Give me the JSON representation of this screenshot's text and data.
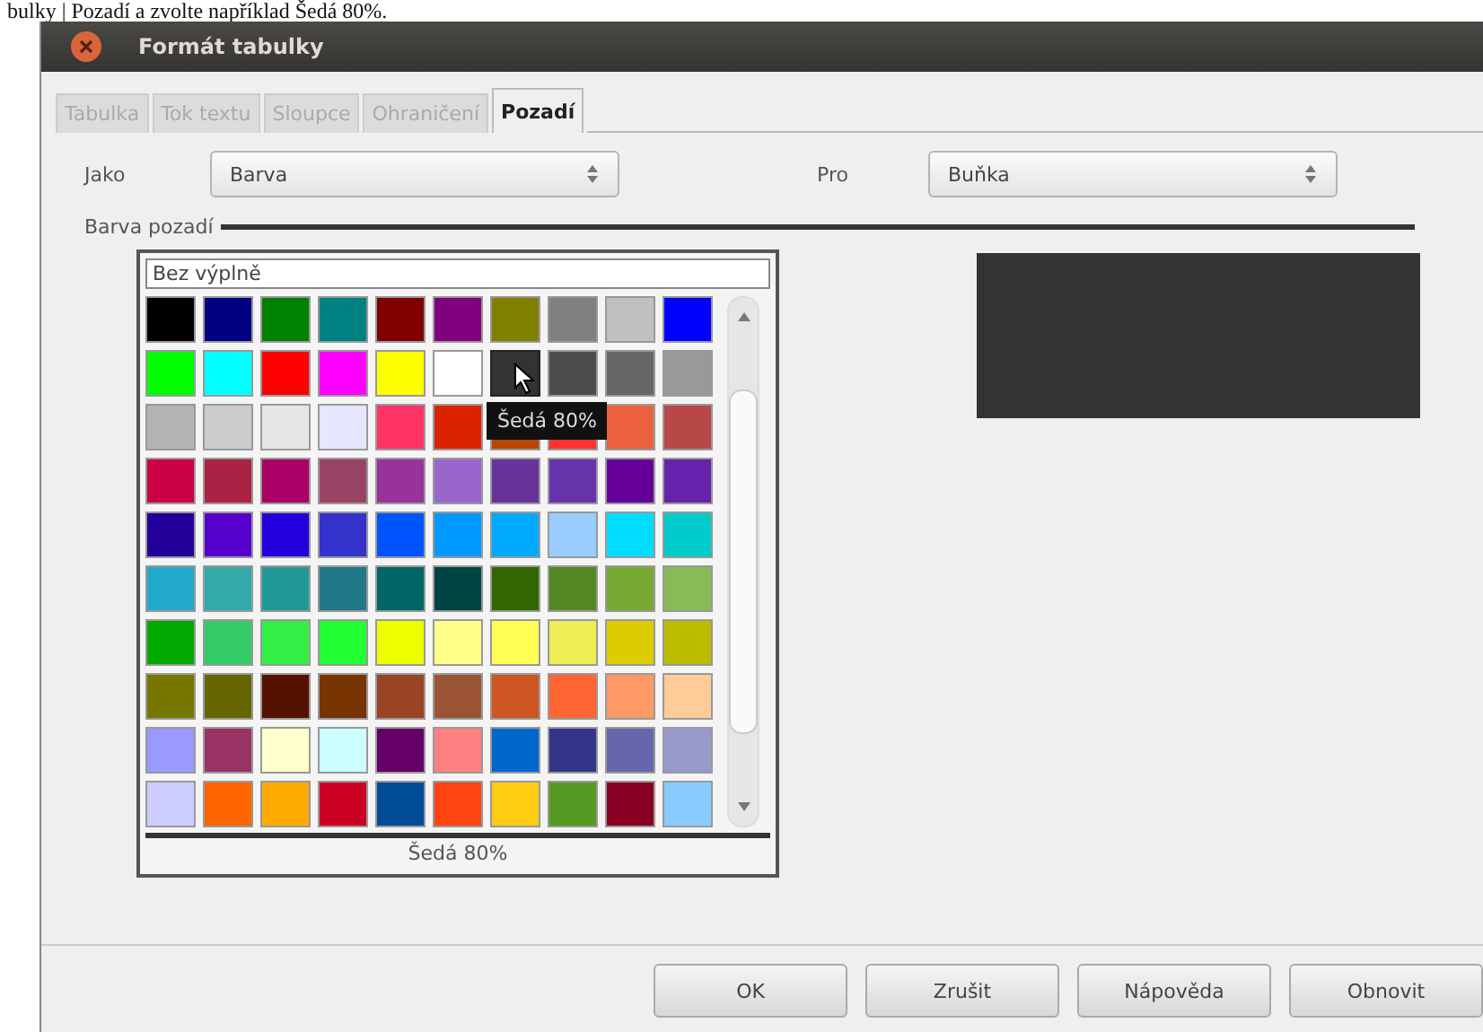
{
  "caption": "bulky | Pozadí a zvolte například Šedá 80%.",
  "window": {
    "title": "Formát tabulky"
  },
  "tabs": [
    {
      "label": "Tabulka",
      "selected": false
    },
    {
      "label": "Tok textu",
      "selected": false
    },
    {
      "label": "Sloupce",
      "selected": false
    },
    {
      "label": "Ohraničení",
      "selected": false
    },
    {
      "label": "Pozadí",
      "selected": true
    }
  ],
  "as_field": {
    "label": "Jako",
    "value": "Barva"
  },
  "for_field": {
    "label": "Pro",
    "value": "Buňka"
  },
  "background_group": {
    "title": "Barva pozadí",
    "no_fill": "Bez výplně",
    "swatches": [
      {
        "color": "#000000",
        "selected": false
      },
      {
        "color": "#000080",
        "selected": false
      },
      {
        "color": "#008000",
        "selected": false
      },
      {
        "color": "#008080",
        "selected": false
      },
      {
        "color": "#800000",
        "selected": false
      },
      {
        "color": "#800080",
        "selected": false
      },
      {
        "color": "#808000",
        "selected": false
      },
      {
        "color": "#808080",
        "selected": false
      },
      {
        "color": "#c0c0c0",
        "selected": false
      },
      {
        "color": "#0000ff",
        "selected": false
      },
      {
        "color": "#00ff00",
        "selected": false
      },
      {
        "color": "#00ffff",
        "selected": false
      },
      {
        "color": "#ff0000",
        "selected": false
      },
      {
        "color": "#ff00ff",
        "selected": false
      },
      {
        "color": "#ffff00",
        "selected": false
      },
      {
        "color": "#ffffff",
        "selected": false
      },
      {
        "color": "#333333",
        "selected": true
      },
      {
        "color": "#4d4d4d",
        "selected": false
      },
      {
        "color": "#666666",
        "selected": false
      },
      {
        "color": "#999999",
        "selected": false
      },
      {
        "color": "#b3b3b3",
        "selected": false
      },
      {
        "color": "#cccccc",
        "selected": false
      },
      {
        "color": "#e6e6e6",
        "selected": false
      },
      {
        "color": "#e6e6ff",
        "selected": false
      },
      {
        "color": "#ff3366",
        "selected": false
      },
      {
        "color": "#dc2300",
        "selected": false
      },
      {
        "color": "#b84700",
        "selected": false
      },
      {
        "color": "#ff3333",
        "selected": false
      },
      {
        "color": "#eb613d",
        "selected": false
      },
      {
        "color": "#b84747",
        "selected": false
      },
      {
        "color": "#cc0044",
        "selected": false
      },
      {
        "color": "#aa2244",
        "selected": false
      },
      {
        "color": "#aa0066",
        "selected": false
      },
      {
        "color": "#994466",
        "selected": false
      },
      {
        "color": "#993399",
        "selected": false
      },
      {
        "color": "#9966cc",
        "selected": false
      },
      {
        "color": "#663399",
        "selected": false
      },
      {
        "color": "#6633aa",
        "selected": false
      },
      {
        "color": "#660099",
        "selected": false
      },
      {
        "color": "#6622aa",
        "selected": false
      },
      {
        "color": "#220099",
        "selected": false
      },
      {
        "color": "#5500cc",
        "selected": false
      },
      {
        "color": "#2200dd",
        "selected": false
      },
      {
        "color": "#3333cc",
        "selected": false
      },
      {
        "color": "#0055ff",
        "selected": false
      },
      {
        "color": "#0099ff",
        "selected": false
      },
      {
        "color": "#00aaff",
        "selected": false
      },
      {
        "color": "#99ccff",
        "selected": false
      },
      {
        "color": "#00ddff",
        "selected": false
      },
      {
        "color": "#00cccc",
        "selected": false
      },
      {
        "color": "#22aacc",
        "selected": false
      },
      {
        "color": "#33aaaa",
        "selected": false
      },
      {
        "color": "#229999",
        "selected": false
      },
      {
        "color": "#227788",
        "selected": false
      },
      {
        "color": "#006666",
        "selected": false
      },
      {
        "color": "#004444",
        "selected": false
      },
      {
        "color": "#336600",
        "selected": false
      },
      {
        "color": "#558822",
        "selected": false
      },
      {
        "color": "#77aa33",
        "selected": false
      },
      {
        "color": "#88bb55",
        "selected": false
      },
      {
        "color": "#00aa00",
        "selected": false
      },
      {
        "color": "#33cc66",
        "selected": false
      },
      {
        "color": "#33ee44",
        "selected": false
      },
      {
        "color": "#22ff33",
        "selected": false
      },
      {
        "color": "#eeff00",
        "selected": false
      },
      {
        "color": "#ffff88",
        "selected": false
      },
      {
        "color": "#ffff55",
        "selected": false
      },
      {
        "color": "#eeee55",
        "selected": false
      },
      {
        "color": "#ddcc00",
        "selected": false
      },
      {
        "color": "#bbbb00",
        "selected": false
      },
      {
        "color": "#777700",
        "selected": false
      },
      {
        "color": "#666600",
        "selected": false
      },
      {
        "color": "#551100",
        "selected": false
      },
      {
        "color": "#773300",
        "selected": false
      },
      {
        "color": "#994422",
        "selected": false
      },
      {
        "color": "#995533",
        "selected": false
      },
      {
        "color": "#cc5522",
        "selected": false
      },
      {
        "color": "#ff6633",
        "selected": false
      },
      {
        "color": "#ff9966",
        "selected": false
      },
      {
        "color": "#ffcc99",
        "selected": false
      },
      {
        "color": "#9999ff",
        "selected": false
      },
      {
        "color": "#993366",
        "selected": false
      },
      {
        "color": "#ffffcc",
        "selected": false
      },
      {
        "color": "#ccffff",
        "selected": false
      },
      {
        "color": "#660066",
        "selected": false
      },
      {
        "color": "#ff8080",
        "selected": false
      },
      {
        "color": "#0066cc",
        "selected": false
      },
      {
        "color": "#333388",
        "selected": false
      },
      {
        "color": "#6666aa",
        "selected": false
      },
      {
        "color": "#9999cc",
        "selected": false
      },
      {
        "color": "#ccccff",
        "selected": false
      },
      {
        "color": "#ff6600",
        "selected": false
      },
      {
        "color": "#ffaa00",
        "selected": false
      },
      {
        "color": "#cc0022",
        "selected": false
      },
      {
        "color": "#004c99",
        "selected": false
      },
      {
        "color": "#ff4411",
        "selected": false
      },
      {
        "color": "#ffcc11",
        "selected": false
      },
      {
        "color": "#559922",
        "selected": false
      },
      {
        "color": "#880022",
        "selected": false
      },
      {
        "color": "#88ccff",
        "selected": false
      }
    ],
    "tooltip": "Šedá 80%",
    "selected_name": "Šedá 80%"
  },
  "buttons": [
    "OK",
    "Zrušit",
    "Nápověda",
    "Obnovit"
  ]
}
